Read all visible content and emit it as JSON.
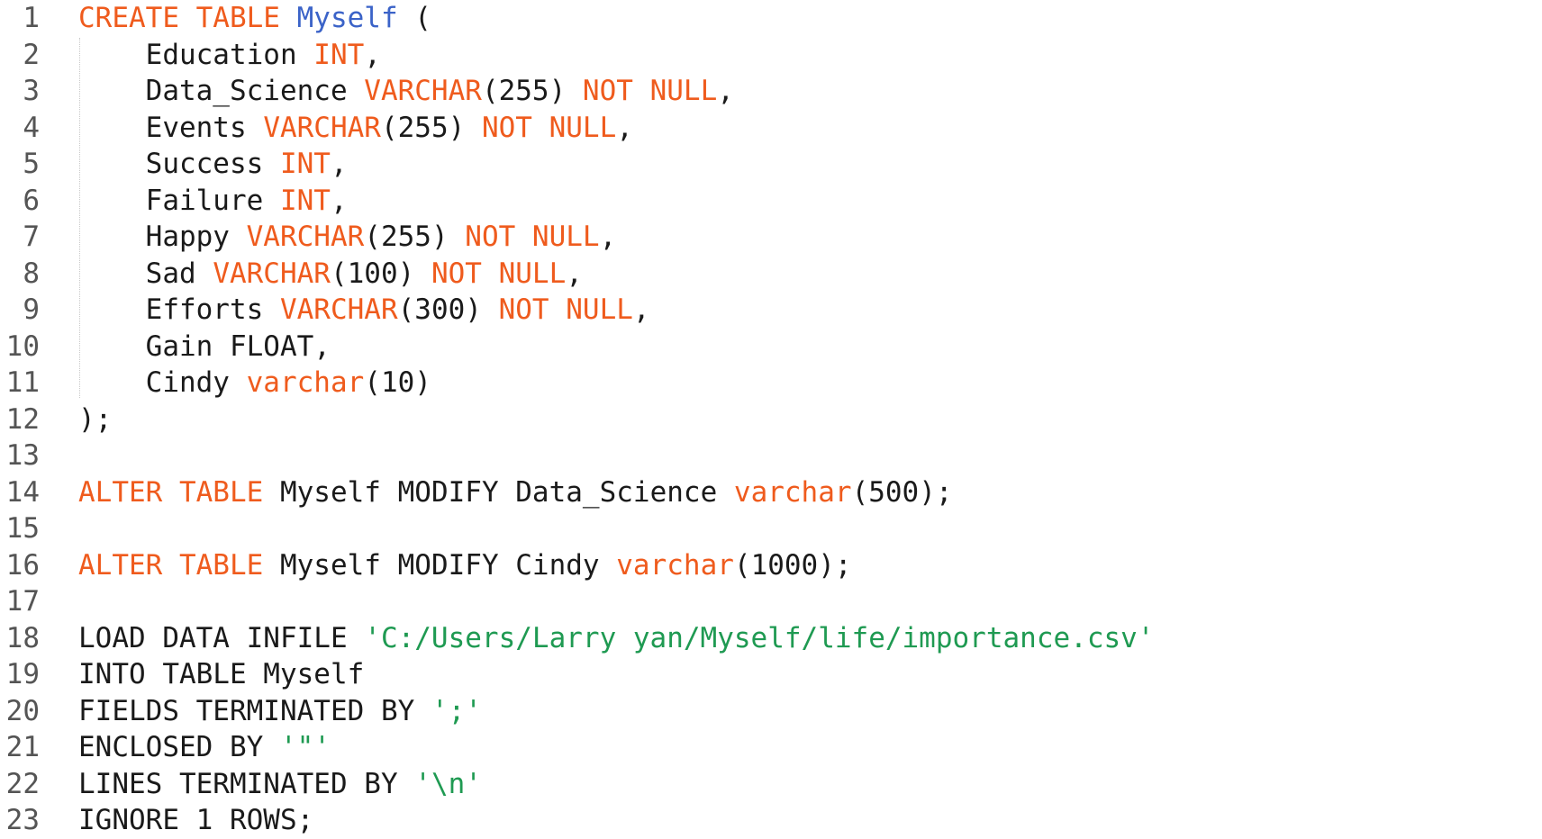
{
  "editor": {
    "lines": [
      [
        {
          "t": "CREATE TABLE",
          "c": "kw"
        },
        {
          "t": " "
        },
        {
          "t": "Myself",
          "c": "tbl"
        },
        {
          "t": " ("
        }
      ],
      [
        {
          "t": "    Education "
        },
        {
          "t": "INT",
          "c": "kw"
        },
        {
          "t": ","
        }
      ],
      [
        {
          "t": "    Data_Science "
        },
        {
          "t": "VARCHAR",
          "c": "kw"
        },
        {
          "t": "(255) "
        },
        {
          "t": "NOT NULL",
          "c": "kw"
        },
        {
          "t": ","
        }
      ],
      [
        {
          "t": "    Events "
        },
        {
          "t": "VARCHAR",
          "c": "kw"
        },
        {
          "t": "(255) "
        },
        {
          "t": "NOT NULL",
          "c": "kw"
        },
        {
          "t": ","
        }
      ],
      [
        {
          "t": "    Success "
        },
        {
          "t": "INT",
          "c": "kw"
        },
        {
          "t": ","
        }
      ],
      [
        {
          "t": "    Failure "
        },
        {
          "t": "INT",
          "c": "kw"
        },
        {
          "t": ","
        }
      ],
      [
        {
          "t": "    Happy "
        },
        {
          "t": "VARCHAR",
          "c": "kw"
        },
        {
          "t": "(255) "
        },
        {
          "t": "NOT NULL",
          "c": "kw"
        },
        {
          "t": ","
        }
      ],
      [
        {
          "t": "    Sad "
        },
        {
          "t": "VARCHAR",
          "c": "kw"
        },
        {
          "t": "(100) "
        },
        {
          "t": "NOT NULL",
          "c": "kw"
        },
        {
          "t": ","
        }
      ],
      [
        {
          "t": "    Efforts "
        },
        {
          "t": "VARCHAR",
          "c": "kw"
        },
        {
          "t": "(300) "
        },
        {
          "t": "NOT NULL",
          "c": "kw"
        },
        {
          "t": ","
        }
      ],
      [
        {
          "t": "    Gain FLOAT,"
        }
      ],
      [
        {
          "t": "    Cindy "
        },
        {
          "t": "varchar",
          "c": "kw"
        },
        {
          "t": "(10)"
        }
      ],
      [
        {
          "t": ");"
        }
      ],
      [],
      [
        {
          "t": "ALTER TABLE",
          "c": "kw"
        },
        {
          "t": " Myself MODIFY Data_Science "
        },
        {
          "t": "varchar",
          "c": "kw"
        },
        {
          "t": "(500);"
        }
      ],
      [],
      [
        {
          "t": "ALTER TABLE",
          "c": "kw"
        },
        {
          "t": " Myself MODIFY Cindy "
        },
        {
          "t": "varchar",
          "c": "kw"
        },
        {
          "t": "(1000);"
        }
      ],
      [],
      [
        {
          "t": "LOAD DATA INFILE "
        },
        {
          "t": "'C:/Users/Larry yan/Myself/life/importance.csv'",
          "c": "str"
        }
      ],
      [
        {
          "t": "INTO TABLE Myself"
        }
      ],
      [
        {
          "t": "FIELDS TERMINATED BY "
        },
        {
          "t": "';'",
          "c": "str"
        }
      ],
      [
        {
          "t": "ENCLOSED BY "
        },
        {
          "t": "'\"'",
          "c": "str"
        }
      ],
      [
        {
          "t": "LINES TERMINATED BY "
        },
        {
          "t": "'\\n'",
          "c": "str"
        }
      ],
      [
        {
          "t": "IGNORE 1 ROWS;"
        }
      ]
    ]
  },
  "colors": {
    "keyword": "#ef5b1d",
    "table_name": "#3b63c8",
    "string": "#1f9a52",
    "text": "#1a1a1a",
    "line_number": "#555555"
  }
}
